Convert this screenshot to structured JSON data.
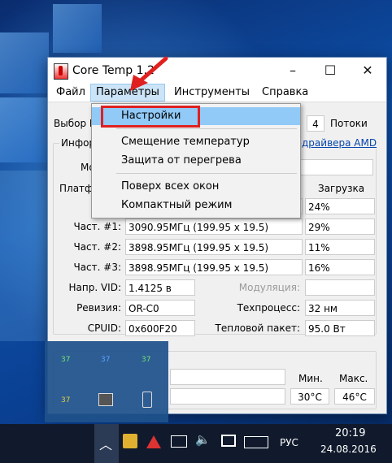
{
  "window": {
    "title": "Core Temp 1.2",
    "minimize": "–",
    "maximize": "☐",
    "close": "✕"
  },
  "menu": [
    "Файл",
    "Параметры",
    "Инструменты",
    "Справка"
  ],
  "dropdown": {
    "items": [
      "Настройки",
      "Смещение температур",
      "Защита от перегрева",
      "Поверх всех окон",
      "Компактный режим"
    ]
  },
  "selection": {
    "label": "Выбор L",
    "threads_value": "4",
    "threads_label": "Потоки"
  },
  "info": {
    "group_label": "Инфор",
    "model_label": "Мо",
    "platform_label": "Платф",
    "amd_link": "драйвера AMD"
  },
  "cores": {
    "load_header": "Загрузка",
    "rows": [
      {
        "label": "Част",
        "freq": "",
        "load": "24%"
      },
      {
        "label": "Част. #1:",
        "freq": "3090.95МГц (199.95 x 19.5)",
        "load": "29%"
      },
      {
        "label": "Част. #2:",
        "freq": "3898.95МГц (199.95 x 19.5)",
        "load": "11%"
      },
      {
        "label": "Част. #3:",
        "freq": "3898.95МГц (199.95 x 19.5)",
        "load": "16%"
      }
    ]
  },
  "specs": {
    "vid_label": "Напр. VID:",
    "vid_value": "1.4125 в",
    "modulation_label": "Модуляция:",
    "modulation_value": "",
    "revision_label": "Ревизия:",
    "revision_value": "OR-C0",
    "process_label": "Техпроцесс:",
    "process_value": "32 нм",
    "cpuid_label": "CPUID:",
    "cpuid_value": "0x600F20",
    "tdp_label": "Тепловой пакет:",
    "tdp_value": "95.0 Вт"
  },
  "temps": {
    "min_header": "Мин.",
    "max_header": "Макс.",
    "min_value": "30°C",
    "max_value": "46°C"
  },
  "tray_popup": {
    "temps": [
      "37",
      "37",
      "37",
      "37"
    ]
  },
  "taskbar": {
    "language": "РУС",
    "time": "20:19",
    "date": "24.08.2016"
  },
  "colors": {
    "arrow": "#e02020",
    "highlight": "#91c9f7",
    "taskbar": "#101a2c"
  }
}
